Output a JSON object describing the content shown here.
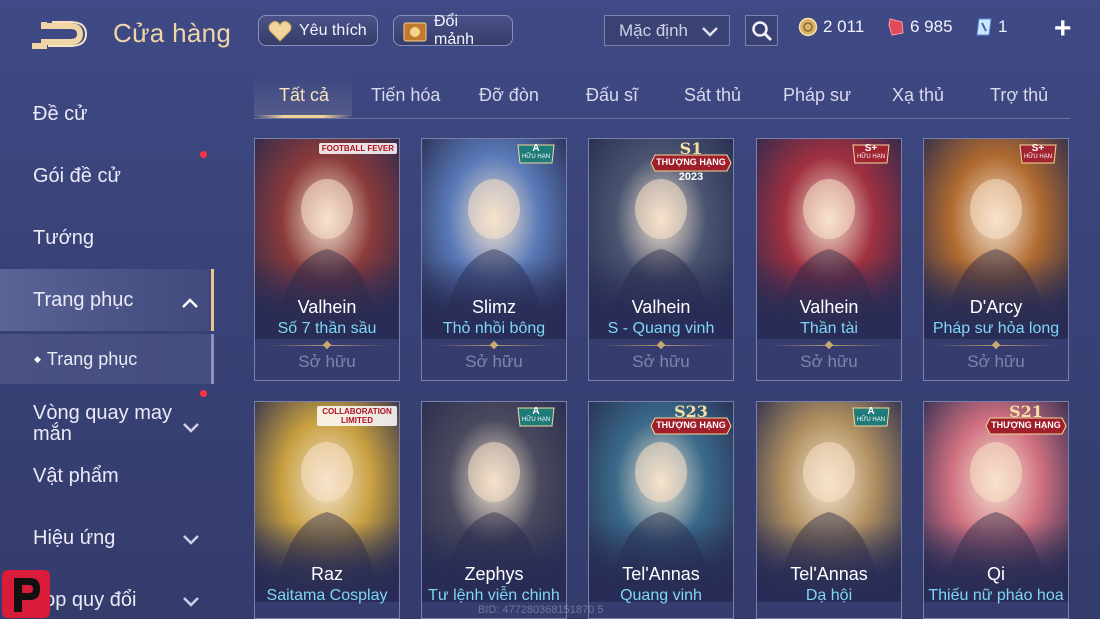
{
  "header": {
    "title": "Cửa hàng",
    "favorite_label": "Yêu thích",
    "exchange_label": "Đổi mảnh",
    "sort_value": "Mặc định",
    "currency": [
      {
        "icon": "gold-coin-icon",
        "value": "2 011"
      },
      {
        "icon": "ruby-gem-icon",
        "value": "6 985"
      },
      {
        "icon": "voucher-icon",
        "value": "1"
      }
    ]
  },
  "sidebar": {
    "items": [
      {
        "label": "Đề cử"
      },
      {
        "label": "Gói đề cử"
      },
      {
        "label": "Tướng"
      },
      {
        "label": "Trang phục"
      },
      {
        "label": "Trang phục"
      },
      {
        "label": "Vòng quay may mắn"
      },
      {
        "label": "Vật phẩm"
      },
      {
        "label": "Hiệu ứng"
      },
      {
        "label": "hop quy đổi"
      }
    ]
  },
  "tabs": [
    "Tất cả",
    "Tiến hóa",
    "Đỡ đòn",
    "Đấu sĩ",
    "Sát thủ",
    "Pháp sư",
    "Xạ thủ",
    "Trợ thủ"
  ],
  "cards": [
    {
      "hero": "Valhein",
      "skin": "Số 7 thần sầu",
      "status": "Sở hữu",
      "badge": "FOOTBALL FEVER",
      "tint": "#8a3a3a"
    },
    {
      "hero": "Slimz",
      "skin": "Thỏ nhồi bông",
      "status": "Sở hữu",
      "badge": "A",
      "badge_sub": "HỮU HẠN",
      "tint": "#5a7ab8"
    },
    {
      "hero": "Valhein",
      "skin": "S - Quang vinh",
      "status": "Sở hữu",
      "badge": "S1",
      "badge_sub": "THƯỢNG HẠNG",
      "badge_year": "2023",
      "tint": "#4a5470"
    },
    {
      "hero": "Valhein",
      "skin": "Thần tài",
      "status": "Sở hữu",
      "badge": "S+",
      "badge_sub": "HỮU HẠN",
      "tint": "#a03040"
    },
    {
      "hero": "D'Arcy",
      "skin": "Pháp sư hỏa long",
      "status": "Sở hữu",
      "badge": "S+",
      "badge_sub": "HỮU HẠN",
      "tint": "#b06a30"
    },
    {
      "hero": "Raz",
      "skin": "Saitama Cosplay",
      "badge": "COLLABORATION LIMITED",
      "tint": "#c8a040"
    },
    {
      "hero": "Zephys",
      "skin": "Tư lệnh viễn chinh",
      "badge": "A",
      "badge_sub": "HỮU HẠN",
      "tint": "#4a4a5e"
    },
    {
      "hero": "Tel'Annas",
      "skin": "Quang vinh",
      "badge": "S23",
      "badge_sub": "THƯỢNG HẠNG",
      "tint": "#3a6a8a"
    },
    {
      "hero": "Tel'Annas",
      "skin": "Dạ hội",
      "badge": "A",
      "badge_sub": "HỮU HẠN",
      "tint": "#b09060"
    },
    {
      "hero": "Qi",
      "skin": "Thiếu nữ pháo hoa",
      "badge": "S21",
      "badge_sub": "THƯỢNG HẠNG",
      "tint": "#d07080"
    }
  ],
  "footer": {
    "watermark": "BID: 477280368151870 5"
  },
  "colors": {
    "accent_gold": "#f1d39a",
    "skin_name": "#7fd6f5",
    "notification": "#ff3344"
  }
}
